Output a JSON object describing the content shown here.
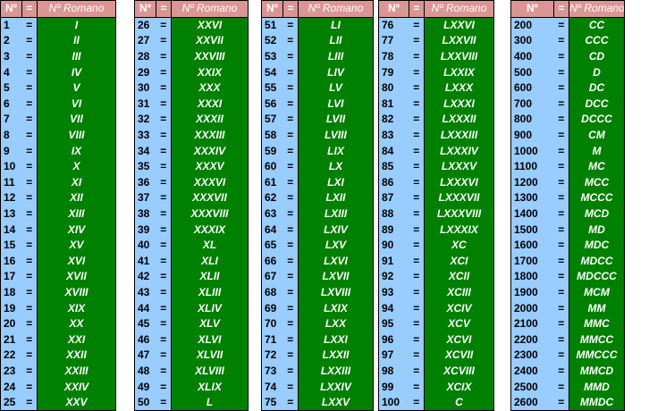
{
  "header": {
    "num": "Nº",
    "eq": "=",
    "roman": "Nº Romano"
  },
  "tables": [
    {
      "rows": [
        [
          "1",
          "I"
        ],
        [
          "2",
          "II"
        ],
        [
          "3",
          "III"
        ],
        [
          "4",
          "IV"
        ],
        [
          "5",
          "V"
        ],
        [
          "6",
          "VI"
        ],
        [
          "7",
          "VII"
        ],
        [
          "8",
          "VIII"
        ],
        [
          "9",
          "IX"
        ],
        [
          "10",
          "X"
        ],
        [
          "11",
          "XI"
        ],
        [
          "12",
          "XII"
        ],
        [
          "13",
          "XIII"
        ],
        [
          "14",
          "XIV"
        ],
        [
          "15",
          "XV"
        ],
        [
          "16",
          "XVI"
        ],
        [
          "17",
          "XVII"
        ],
        [
          "18",
          "XVIII"
        ],
        [
          "19",
          "XIX"
        ],
        [
          "20",
          "XX"
        ],
        [
          "21",
          "XXI"
        ],
        [
          "22",
          "XXII"
        ],
        [
          "23",
          "XXIII"
        ],
        [
          "24",
          "XXIV"
        ],
        [
          "25",
          "XXV"
        ]
      ]
    },
    {
      "rows": [
        [
          "26",
          "XXVI"
        ],
        [
          "27",
          "XXVII"
        ],
        [
          "28",
          "XXVIII"
        ],
        [
          "29",
          "XXIX"
        ],
        [
          "30",
          "XXX"
        ],
        [
          "31",
          "XXXI"
        ],
        [
          "32",
          "XXXII"
        ],
        [
          "33",
          "XXXIII"
        ],
        [
          "34",
          "XXXIV"
        ],
        [
          "35",
          "XXXV"
        ],
        [
          "36",
          "XXXVI"
        ],
        [
          "37",
          "XXXVII"
        ],
        [
          "38",
          "XXXVIII"
        ],
        [
          "39",
          "XXXIX"
        ],
        [
          "40",
          "XL"
        ],
        [
          "41",
          "XLI"
        ],
        [
          "42",
          "XLII"
        ],
        [
          "43",
          "XLIII"
        ],
        [
          "44",
          "XLIV"
        ],
        [
          "45",
          "XLV"
        ],
        [
          "46",
          "XLVI"
        ],
        [
          "47",
          "XLVII"
        ],
        [
          "48",
          "XLVIII"
        ],
        [
          "49",
          "XLIX"
        ],
        [
          "50",
          "L"
        ]
      ]
    },
    {
      "rows": [
        [
          "51",
          "LI"
        ],
        [
          "52",
          "LII"
        ],
        [
          "53",
          "LIII"
        ],
        [
          "54",
          "LIV"
        ],
        [
          "55",
          "LV"
        ],
        [
          "56",
          "LVI"
        ],
        [
          "57",
          "LVII"
        ],
        [
          "58",
          "LVIII"
        ],
        [
          "59",
          "LIX"
        ],
        [
          "60",
          "LX"
        ],
        [
          "61",
          "LXI"
        ],
        [
          "62",
          "LXII"
        ],
        [
          "63",
          "LXIII"
        ],
        [
          "64",
          "LXIV"
        ],
        [
          "65",
          "LXV"
        ],
        [
          "66",
          "LXVI"
        ],
        [
          "67",
          "LXVII"
        ],
        [
          "68",
          "LXVIII"
        ],
        [
          "69",
          "LXIX"
        ],
        [
          "70",
          "LXX"
        ],
        [
          "71",
          "LXXI"
        ],
        [
          "72",
          "LXXII"
        ],
        [
          "73",
          "LXXIII"
        ],
        [
          "74",
          "LXXIV"
        ],
        [
          "75",
          "LXXV"
        ]
      ]
    },
    {
      "rows": [
        [
          "76",
          "LXXVI"
        ],
        [
          "77",
          "LXXVII"
        ],
        [
          "78",
          "LXXVIII"
        ],
        [
          "79",
          "LXXIX"
        ],
        [
          "80",
          "LXXX"
        ],
        [
          "81",
          "LXXXI"
        ],
        [
          "82",
          "LXXXII"
        ],
        [
          "83",
          "LXXXIII"
        ],
        [
          "84",
          "LXXXIV"
        ],
        [
          "85",
          "LXXXV"
        ],
        [
          "86",
          "LXXXVI"
        ],
        [
          "87",
          "LXXXVII"
        ],
        [
          "88",
          "LXXXVIII"
        ],
        [
          "89",
          "LXXXIX"
        ],
        [
          "90",
          "XC"
        ],
        [
          "91",
          "XCI"
        ],
        [
          "92",
          "XCII"
        ],
        [
          "93",
          "XCIII"
        ],
        [
          "94",
          "XCIV"
        ],
        [
          "95",
          "XCV"
        ],
        [
          "96",
          "XCVI"
        ],
        [
          "97",
          "XCVII"
        ],
        [
          "98",
          "XCVIII"
        ],
        [
          "99",
          "XCIX"
        ],
        [
          "100",
          "C"
        ]
      ]
    },
    {
      "rows": [
        [
          "200",
          "CC"
        ],
        [
          "300",
          "CCC"
        ],
        [
          "400",
          "CD"
        ],
        [
          "500",
          "D"
        ],
        [
          "600",
          "DC"
        ],
        [
          "700",
          "DCC"
        ],
        [
          "800",
          "DCCC"
        ],
        [
          "900",
          "CM"
        ],
        [
          "1000",
          "M"
        ],
        [
          "1100",
          "MC"
        ],
        [
          "1200",
          "MCC"
        ],
        [
          "1300",
          "MCCC"
        ],
        [
          "1400",
          "MCD"
        ],
        [
          "1500",
          "MD"
        ],
        [
          "1600",
          "MDC"
        ],
        [
          "1700",
          "MDCC"
        ],
        [
          "1800",
          "MDCCC"
        ],
        [
          "1900",
          "MCM"
        ],
        [
          "2000",
          "MM"
        ],
        [
          "2100",
          "MMC"
        ],
        [
          "2200",
          "MMCC"
        ],
        [
          "2300",
          "MMCCC"
        ],
        [
          "2400",
          "MMCD"
        ],
        [
          "2500",
          "MMD"
        ],
        [
          "2600",
          "MMDC"
        ]
      ]
    }
  ]
}
